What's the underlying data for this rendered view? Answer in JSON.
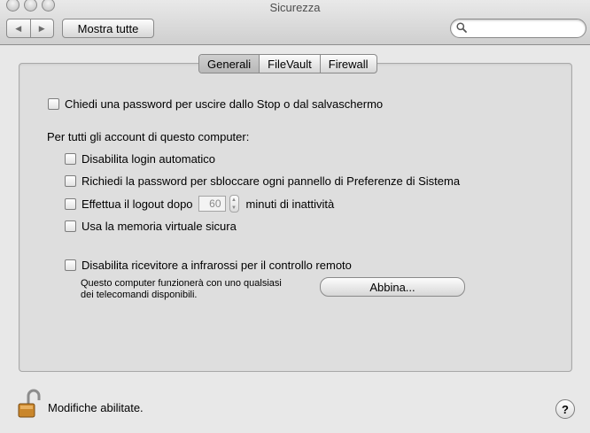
{
  "window": {
    "title": "Sicurezza",
    "nav_back_icon": "triangle-left",
    "nav_forward_icon": "triangle-right",
    "show_all_label": "Mostra tutte",
    "search_placeholder": "",
    "search_icon": "magnifier"
  },
  "tabs": [
    {
      "label": "Generali",
      "selected": true
    },
    {
      "label": "FileVault",
      "selected": false
    },
    {
      "label": "Firewall",
      "selected": false
    }
  ],
  "general": {
    "password_on_wake": {
      "label": "Chiedi una password per uscire dallo Stop o dal salvaschermo",
      "checked": false
    },
    "section_heading": "Per tutti gli account di questo computer:",
    "disable_auto_login": {
      "label": "Disabilita login automatico",
      "checked": false
    },
    "require_password_prefs": {
      "label": "Richiedi la password per sbloccare ogni pannello di Preferenze di Sistema",
      "checked": false
    },
    "logout_after": {
      "label_before": "Effettua il logout dopo",
      "minutes": "60",
      "label_after": "minuti di inattività",
      "checked": false
    },
    "secure_virtual_memory": {
      "label": "Usa la memoria virtuale sicura",
      "checked": false
    },
    "disable_ir_receiver": {
      "label": "Disabilita ricevitore a infrarossi per il controllo remoto",
      "checked": false
    },
    "ir_note_line1": "Questo computer funzionerà con uno qualsiasi",
    "ir_note_line2": "dei telecomandi disponibili.",
    "pair_button_label": "Abbina..."
  },
  "footer": {
    "lock_icon": "unlocked-padlock",
    "lock_label": "Modifiche abilitate.",
    "help_label": "?"
  }
}
